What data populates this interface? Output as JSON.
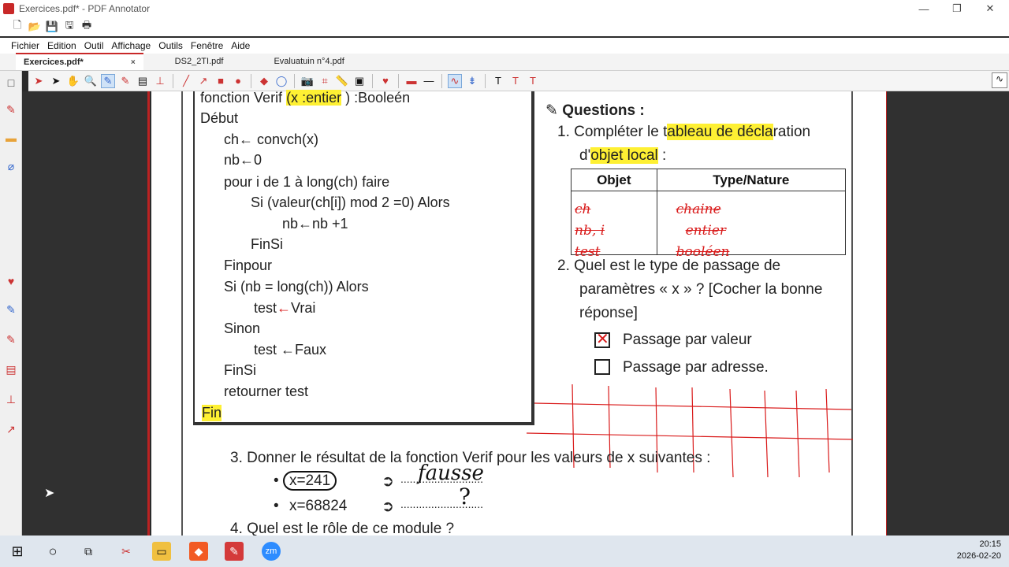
{
  "window": {
    "title": "Exercices.pdf* - PDF Annotator",
    "minimize": "—",
    "restore": "❐",
    "close": "✕"
  },
  "menu": [
    "Fichier",
    "Edition",
    "Outil",
    "Affichage",
    "Outils",
    "Fenêtre",
    "Aide"
  ],
  "tabs": [
    {
      "label": "Exercices.pdf*",
      "close": "×"
    },
    {
      "label": "DS2_2TI.pdf"
    },
    {
      "label": "Evaluatuin n°4.pdf"
    }
  ],
  "code": {
    "l1a": "fonction Verif ",
    "l1b": "(x :entier",
    "l1c": " ) :Booleén",
    "l2": "Début",
    "l3": "ch← convch(x)",
    "l4": "nb←0",
    "l5": "pour i de 1 à long(ch) faire",
    "l6": "Si (valeur(ch[i]) mod 2 =0) Alors",
    "l7": "nb←nb +1",
    "l8": "FinSi",
    "l9": "Finpour",
    "l10": "Si (nb = long(ch)) Alors",
    "l11a": "test",
    "l11b": "←",
    "l11c": "Vrai",
    "l12": "Sinon",
    "l13": "test ←Faux",
    "l14": "FinSi",
    "l15": "retourner  test",
    "l16": "Fin"
  },
  "questions": {
    "title": "Questions  :",
    "q1a": "1.  Compléter le t",
    "q1b": "ableau de décla",
    "q1c": "ration",
    "q1d": "d'",
    "q1e": "objet local",
    "q1f": " :",
    "table": {
      "h1": "Objet",
      "h2": "Type/Nature",
      "rows": [
        [
          "ch",
          "chaine"
        ],
        [
          "nb, i",
          "entier"
        ],
        [
          "test",
          "booléen"
        ]
      ]
    },
    "q2a": "2.  Quel est le type de passage de",
    "q2b": "paramètres « x » ? [Cocher la bonne",
    "q2c": "réponse]",
    "opt1": "Passage par valeur",
    "opt2": "Passage par adresse.",
    "q3": "3.  Donner le résultat de la fonction Verif pour les valeurs de x suivantes :",
    "x1": "x=241",
    "x2": "x=68824",
    "arrow": "➲",
    "dots": "...........................",
    "ans1": "fausse",
    "ans2": "?",
    "q4": "4.  Quel est le rôle de ce module ?"
  },
  "clock": {
    "time": "20:15",
    "date": "2026-02-20"
  },
  "taskbar": {
    "zoom": "zm"
  }
}
